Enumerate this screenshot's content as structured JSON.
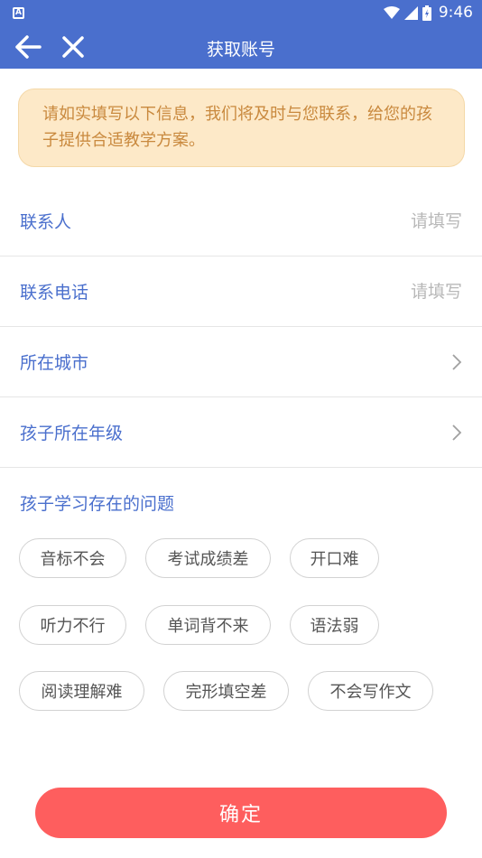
{
  "status_bar": {
    "time": "9:46",
    "indicator": "A"
  },
  "app_bar": {
    "title": "获取账号"
  },
  "notice": {
    "text": "请如实填写以下信息，我们将及时与您联系，给您的孩子提供合适教学方案。"
  },
  "form": {
    "contact_name": {
      "label": "联系人",
      "placeholder": "请填写"
    },
    "contact_phone": {
      "label": "联系电话",
      "placeholder": "请填写"
    },
    "city": {
      "label": "所在城市"
    },
    "grade": {
      "label": "孩子所在年级"
    }
  },
  "problems": {
    "title": "孩子学习存在的问题",
    "tags": [
      "音标不会",
      "考试成绩差",
      "开口难",
      "听力不行",
      "单词背不来",
      "语法弱",
      "阅读理解难",
      "完形填空差",
      "不会写作文"
    ]
  },
  "confirm_button": {
    "label": "确定"
  },
  "colors": {
    "primary": "#4a6fcd",
    "notice_bg": "#fde9c8",
    "notice_text": "#c9893e",
    "button": "#fe5e5e"
  }
}
